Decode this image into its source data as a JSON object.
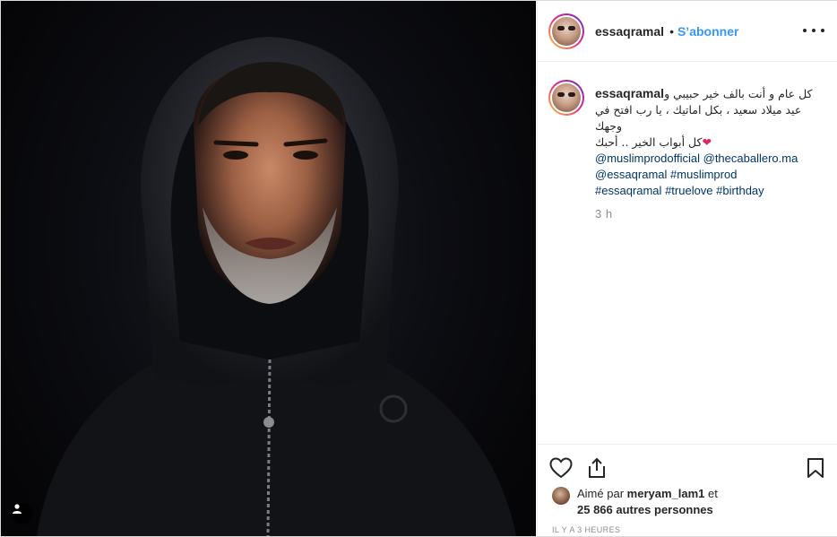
{
  "post": {
    "username": "essaqramal",
    "follow_label": "S’abonner",
    "dot": "•"
  },
  "caption": {
    "username": "essaqramal",
    "line1": "كل عام و أنت بالف خير حبيبي و",
    "line2": "عيد ميلاد سعيد ، بكل اماتيك ، يا رب افتح في وجهك",
    "line3": "كل أبواب الخير .. أحبك",
    "heart": "❤",
    "tags": [
      "@muslimprodofficial",
      "@thecaballero.ma",
      "@essaqramal",
      "#muslimprod",
      "#essaqramal",
      "#truelove",
      "#birthday"
    ],
    "time_ago": "3 h"
  },
  "likes": {
    "prefix": "Aimé par",
    "liker": "meryam_lam1",
    "conj": "et",
    "others": "25 866 autres personnes"
  },
  "post_time": "IL Y A 3 HEURES",
  "icons": {
    "more": "more-options-icon",
    "like": "heart-outline-icon",
    "share": "share-icon",
    "save": "bookmark-icon",
    "user_tag": "user-tag-icon"
  }
}
